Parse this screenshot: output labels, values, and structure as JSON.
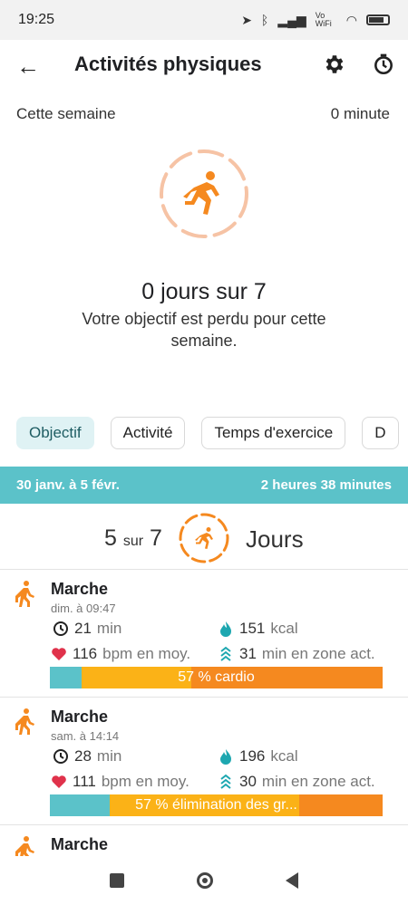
{
  "status": {
    "time": "19:25",
    "vowifi": "Vo WiFi"
  },
  "header": {
    "title": "Activités physiques"
  },
  "week": {
    "label": "Cette semaine",
    "value": "0 minute",
    "days": "0 jours sur 7",
    "message": "Votre objectif est perdu pour cette semaine."
  },
  "tabs": [
    {
      "label": "Objectif"
    },
    {
      "label": "Activité"
    },
    {
      "label": "Temps d'exercice"
    },
    {
      "label": "D"
    }
  ],
  "period": {
    "range": "30 janv. à 5 févr.",
    "total": "2 heures 38 minutes"
  },
  "summary": {
    "count": "5",
    "of": "sur",
    "total": "7",
    "unit": "Jours"
  },
  "activities": [
    {
      "name": "Marche",
      "time": "dim. à 09:47",
      "duration": "21",
      "duration_unit": "min",
      "calories": "151",
      "calories_unit": "kcal",
      "heart": "116",
      "heart_unit": "bpm en moy.",
      "zone": "31",
      "zone_unit": "min en zone act.",
      "bar_label": "57 % cardio",
      "segments": [
        0.095,
        0.33,
        0.575
      ]
    },
    {
      "name": "Marche",
      "time": "sam. à 14:14",
      "duration": "28",
      "duration_unit": "min",
      "calories": "196",
      "calories_unit": "kcal",
      "heart": "111",
      "heart_unit": "bpm en moy.",
      "zone": "30",
      "zone_unit": "min en zone act.",
      "bar_label": "57 % élimination des gr...",
      "segments": [
        0.18,
        0.57,
        0.25
      ]
    },
    {
      "name": "Marche"
    }
  ],
  "colors": {
    "teal": "#5bc2c9",
    "orange": "#f5891f",
    "yellow": "#fbb217",
    "peach": "#f6c3a5",
    "heart": "#e0324b"
  }
}
